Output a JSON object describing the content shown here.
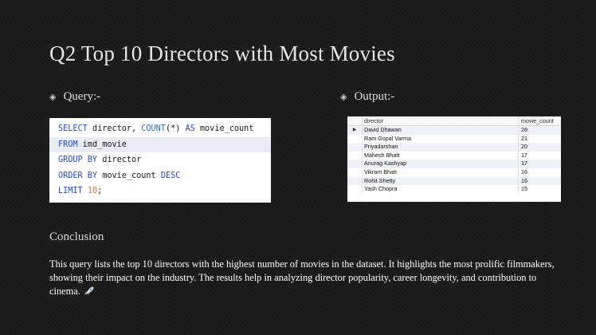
{
  "slide": {
    "title": "Q2 Top 10 Directors with Most Movies",
    "query_label": "Query:-",
    "output_label": "Output:-",
    "conclusion_heading": "Conclusion",
    "conclusion_text": "This query lists the top 10 directors with the highest number of movies in the dataset. It highlights the most prolific filmmakers, showing their impact on the industry. The results help in analyzing director popularity, career longevity, and contribution to cinema."
  },
  "sql": {
    "line1": {
      "kw1": "SELECT",
      "t1": " director, ",
      "fn": "COUNT",
      "t2": "(*) ",
      "kw2": "AS",
      "t3": " movie_count"
    },
    "line2": {
      "kw1": "FROM",
      "t1": " imd_movie"
    },
    "line3": {
      "kw1": "GROUP BY",
      "t1": " director"
    },
    "line4": {
      "kw1": "ORDER BY",
      "t1": " movie_count ",
      "kw2": "DESC"
    },
    "line5": {
      "kw1": "LIMIT",
      "sp": " ",
      "num": "10",
      "t1": ";"
    }
  },
  "output": {
    "columns": [
      "director",
      "movie_count"
    ],
    "rows": [
      {
        "director": "David Dhawan",
        "count": "28"
      },
      {
        "director": "Ram Gopal Varma",
        "count": "21"
      },
      {
        "director": "Priyadarshan",
        "count": "20"
      },
      {
        "director": "Mahesh Bhatt",
        "count": "17"
      },
      {
        "director": "Anurag Kashyap",
        "count": "17"
      },
      {
        "director": "Vikram Bhatt",
        "count": "16"
      },
      {
        "director": "Rohit Shetty",
        "count": "16"
      },
      {
        "director": "Yash Chopra",
        "count": "15"
      }
    ],
    "row_marker": "▶"
  },
  "icons": {
    "bullet": "diamond-bullet-icon",
    "emoji": "rocket-icon"
  },
  "colors": {
    "background": "#1c1c1c",
    "keyword": "#2b4bb4",
    "number": "#e07a18"
  }
}
